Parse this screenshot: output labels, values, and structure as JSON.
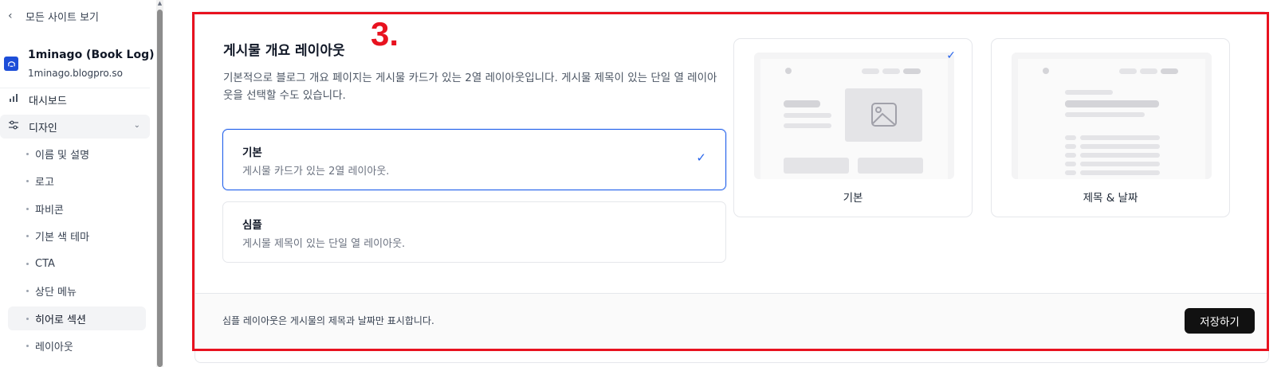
{
  "sidebar": {
    "back_label": "모든 사이트 보기",
    "site_name": "1minago (Book Log)",
    "site_url": "1minago.blogpro.so",
    "nav": {
      "dashboard": "대시보드",
      "design": "디자인"
    },
    "sub_items": [
      {
        "label": "이름 및 설명"
      },
      {
        "label": "로고"
      },
      {
        "label": "파비콘"
      },
      {
        "label": "기본 색 테마"
      },
      {
        "label": "CTA"
      },
      {
        "label": "상단 메뉴"
      },
      {
        "label": "히어로 섹션"
      },
      {
        "label": "레이아웃"
      }
    ],
    "active_sub": "히어로 섹션"
  },
  "section": {
    "title": "게시물 개요 레이아웃",
    "annotation": "3.",
    "description": "기본적으로 블로그 개요 페이지는 게시물 카드가 있는 2열 레이아웃입니다. 게시물 제목이 있는 단일 열 레이아웃을 선택할 수도 있습니다.",
    "options": [
      {
        "title": "기본",
        "desc": "게시물 카드가 있는 2열 레이아웃.",
        "selected": true
      },
      {
        "title": "심플",
        "desc": "게시물 제목이 있는 단일 열 레이아웃.",
        "selected": false
      }
    ],
    "previews": [
      {
        "label": "기본",
        "selected": true
      },
      {
        "label": "제목 & 날짜",
        "selected": false
      }
    ],
    "footer_note": "심플 레이아웃은 게시물의 제목과 날짜만 표시합니다.",
    "save_label": "저장하기"
  },
  "colors": {
    "accent": "#2563eb",
    "annotation_red": "#e8121f",
    "button_dark": "#111111"
  },
  "icons": {
    "back": "chevron-left-icon",
    "dashboard": "bar-chart-icon",
    "design": "sliders-icon",
    "expand": "chevron-down-icon",
    "check": "check-icon",
    "image": "image-placeholder-icon"
  }
}
